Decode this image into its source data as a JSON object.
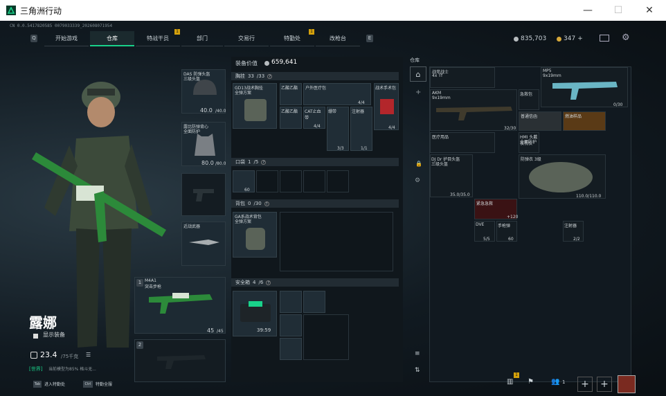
{
  "window": {
    "title": "三角洲行动",
    "min": "—",
    "max": "☐",
    "close": "✕"
  },
  "build_id": "CN 0.0.5417820585 0079033339_202608071954",
  "nav": {
    "left_key": "Q",
    "right_key": "E",
    "tabs": [
      "开始游戏",
      "仓库",
      "特战干员",
      "部门",
      "交易行",
      "特勤处",
      "改枪台"
    ],
    "active": "仓库",
    "badges": [
      "1",
      "1"
    ]
  },
  "currency": {
    "koens": "835,703",
    "gold": "347",
    "gold_plus": "+"
  },
  "operator": {
    "name": "露娜",
    "show_gear": "显示装备",
    "weight": "23.4",
    "weight_max": "/75千克",
    "status": "[世界]",
    "status_text": "当前模型为85% 格斗无..."
  },
  "gear": {
    "helmet": {
      "name": "DAS 防弹头盔",
      "sub": "三级头盔",
      "val": "40.0",
      "max": "/40.0"
    },
    "armor": {
      "name": "露比防弹背心",
      "sub": "全面防护",
      "val": "80.0",
      "max": "/80.0"
    },
    "knife": {
      "name": "近战武器"
    },
    "primary": {
      "key": "1",
      "name": "M4A1",
      "sub": "突击步枪",
      "ammo": "45",
      "ammo_max": "/45"
    },
    "secondary": {
      "key": "2"
    }
  },
  "loadout": {
    "title": "装备价值",
    "value": "659,641",
    "chest": {
      "label": "胸挂",
      "cap": "33",
      "cap_max": "/33",
      "q": "?",
      "items": [
        {
          "name": "GD13战术胸挂",
          "sub": "全弹方案"
        },
        {
          "name": "乙酸乙酯"
        },
        {
          "name": "户外医疗包",
          "qty": "4/4"
        },
        {
          "name": "战术手术包",
          "qty": "4/4"
        },
        {
          "name": "乙酸乙酯"
        },
        {
          "name": "CAT止血带",
          "qty": "4/4"
        },
        {
          "name": "绷带",
          "qty": "3/3"
        },
        {
          "name": "注射器",
          "qty": "1/1"
        }
      ]
    },
    "pocket": {
      "label": "口袋",
      "cap": "1",
      "cap_max": "/5",
      "q": "?",
      "item_qty": "60"
    },
    "backpack": {
      "label": "背包",
      "cap": "0",
      "cap_max": "/30",
      "q": "?",
      "item": "GA系战术背包",
      "sub": "全弹方案"
    },
    "safebox": {
      "label": "安全箱",
      "cap": "4",
      "cap_max": "/6",
      "q": "?",
      "time": "39:59"
    }
  },
  "stash": {
    "label": "仓库",
    "items": [
      {
        "name": "战斧战士",
        "sub": "4x Tf"
      },
      {
        "name": "MP5",
        "sub": "9x19mm",
        "qty": "0/30"
      },
      {
        "name": "AKM",
        "sub": "9x19mm"
      },
      {
        "name": "急救包",
        "qty": "32/30"
      },
      {
        "name": "普通信函"
      },
      {
        "name": "燃油样品"
      },
      {
        "name": "医疗用品"
      },
      {
        "name": "HMI 头戴夜视仪",
        "sub": "全面防护"
      },
      {
        "name": "防弹衣 3级",
        "qty": "110.0/110.0"
      },
      {
        "name": "DJ Dr 护目头盔",
        "sub": "三级头盔",
        "qty": "35.0/35.0"
      },
      {
        "name": "紧急急救",
        "qty": "+120"
      },
      {
        "name": "DVE",
        "qty": "5/5"
      },
      {
        "name": "手枪弹",
        "qty": "60"
      },
      {
        "name": "注射器",
        "qty": "2/2"
      }
    ]
  },
  "bottom": {
    "tab_key": "Tab",
    "tab_label": "进入特勤处",
    "ctrl_key": "Ctrl",
    "ctrl_label": "特勤全服",
    "badge": "1",
    "friends": "1"
  },
  "colors": {
    "accent": "#19d28a",
    "gold": "#d7a93a",
    "red": "#b3262b",
    "warn": "#d4a10c"
  }
}
